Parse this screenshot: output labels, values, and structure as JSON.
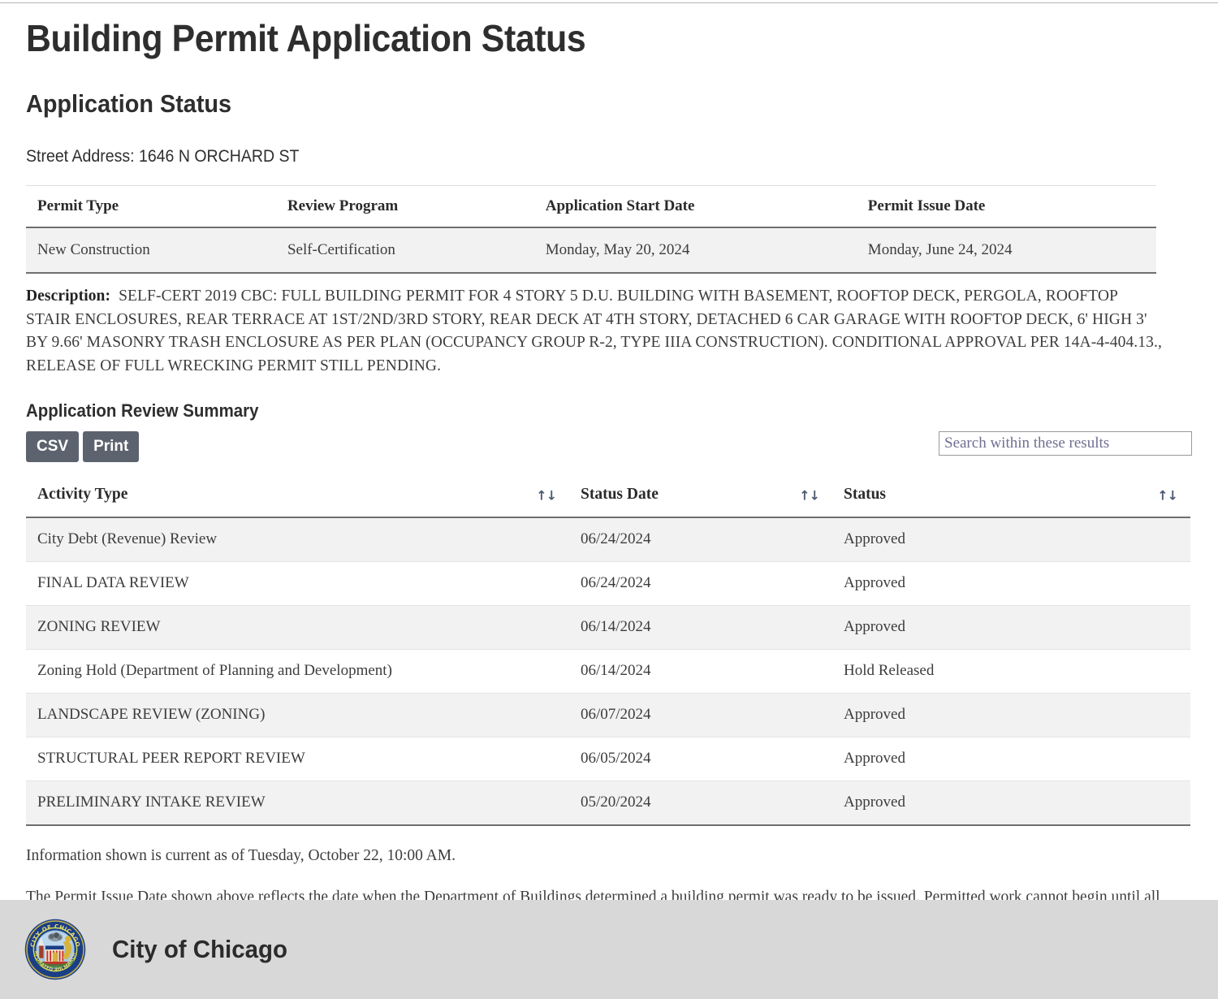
{
  "page": {
    "title": "Building Permit Application Status",
    "section_title": "Application Status",
    "street_address": "Street Address: 1646 N ORCHARD ST"
  },
  "permit_table": {
    "headers": [
      "Permit Type",
      "Review Program",
      "Application Start Date",
      "Permit Issue Date"
    ],
    "row": [
      "New Construction",
      "Self-Certification",
      "Monday, May 20, 2024",
      "Monday, June 24, 2024"
    ]
  },
  "description": {
    "label": "Description:",
    "text": "SELF-CERT 2019 CBC: FULL BUILDING PERMIT FOR 4 STORY 5 D.U. BUILDING WITH BASEMENT, ROOFTOP DECK, PERGOLA, ROOFTOP STAIR ENCLOSURES, REAR TERRACE AT 1ST/2ND/3RD STORY, REAR DECK AT 4TH STORY, DETACHED 6 CAR GARAGE WITH ROOFTOP DECK, 6' HIGH 3' BY 9.66' MASONRY TRASH ENCLOSURE AS PER PLAN (OCCUPANCY GROUP R-2, TYPE IIIA CONSTRUCTION). CONDITIONAL APPROVAL PER 14A-4-404.13., RELEASE OF FULL WRECKING PERMIT STILL PENDING."
  },
  "review_summary": {
    "heading": "Application Review Summary",
    "csv_label": "CSV",
    "print_label": "Print",
    "search_placeholder": "Search within these results",
    "search_value": "",
    "sort_icon": "↑↓",
    "headers": [
      "Activity Type",
      "Status Date",
      "Status"
    ],
    "rows": [
      {
        "activity": "City Debt (Revenue) Review",
        "date": "06/24/2024",
        "status": "Approved"
      },
      {
        "activity": "FINAL DATA REVIEW",
        "date": "06/24/2024",
        "status": "Approved"
      },
      {
        "activity": "ZONING REVIEW",
        "date": "06/14/2024",
        "status": "Approved"
      },
      {
        "activity": "Zoning Hold (Department of Planning and Development)",
        "date": "06/14/2024",
        "status": "Hold Released"
      },
      {
        "activity": "LANDSCAPE REVIEW (ZONING)",
        "date": "06/07/2024",
        "status": "Approved"
      },
      {
        "activity": "STRUCTURAL PEER REPORT REVIEW",
        "date": "06/05/2024",
        "status": "Approved"
      },
      {
        "activity": "PRELIMINARY INTAKE REVIEW",
        "date": "05/20/2024",
        "status": "Approved"
      }
    ]
  },
  "notes": {
    "currency": "Information shown is current as of Tuesday, October 22, 10:00 AM.",
    "disclaimer": "The Permit Issue Date shown above reflects the date when the Department of Buildings determined a building permit was ready to be issued. Permitted work cannot begin until all permit fees have been paid in full."
  },
  "footer": {
    "label": "City of Chicago",
    "seal_text_top": "CITY OF CHICAGO",
    "seal_text_bottom": "INCORPORATED 4th MARCH 1837"
  },
  "colors": {
    "button": "#5d636e",
    "footer_band": "#d8d8d8",
    "row_stripe": "#f2f2f2",
    "rule": "#6f6f6f"
  }
}
